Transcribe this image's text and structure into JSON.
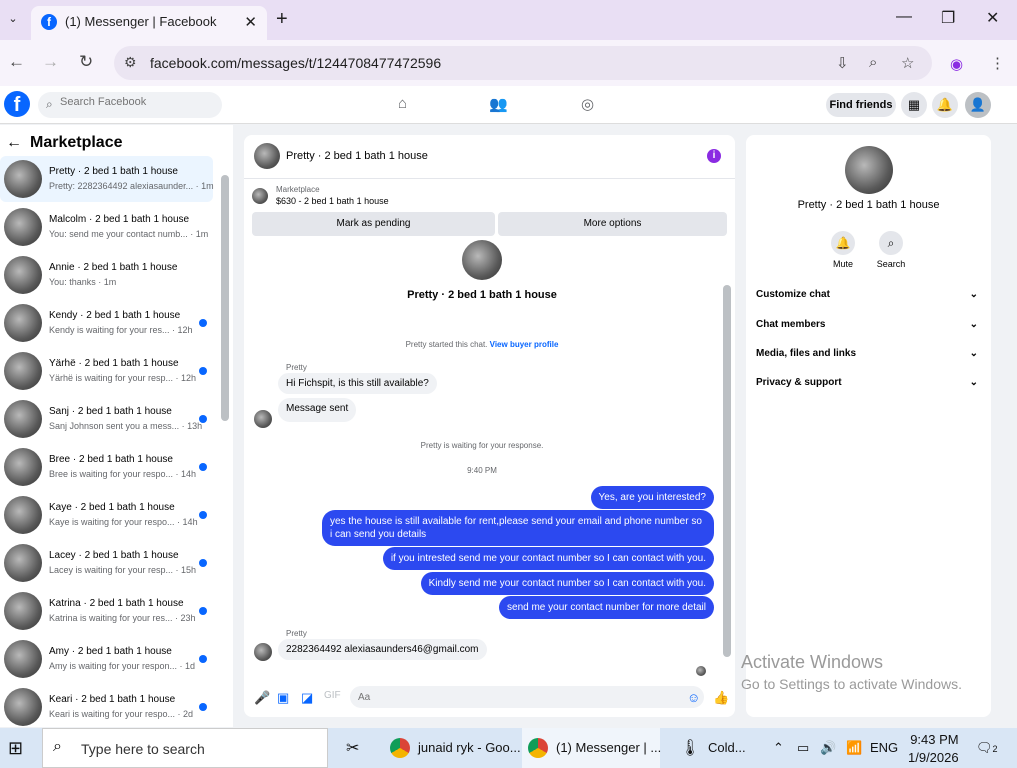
{
  "browser": {
    "tab_title": "(1) Messenger | Facebook",
    "tab_favicon": "f",
    "url": "facebook.com/messages/t/1244708477472596"
  },
  "fb": {
    "logo": "f",
    "search_placeholder": "Search Facebook",
    "find_friends": "Find friends"
  },
  "left": {
    "title": "Marketplace",
    "conversations": [
      {
        "name": "Pretty · 2 bed 1 bath 1 house",
        "snippet": "Pretty: 2282364492 alexiasaunder... · 1m",
        "unread": false
      },
      {
        "name": "Malcolm · 2 bed 1 bath 1 house",
        "snippet": "You: send me your contact numb... · 1m",
        "unread": false
      },
      {
        "name": "Annie · 2 bed 1 bath 1 house",
        "snippet": "You: thanks · 1m",
        "unread": false
      },
      {
        "name": "Kendy · 2 bed 1 bath 1 house",
        "snippet": "Kendy is waiting for your res... · 12h",
        "unread": true
      },
      {
        "name": "Yärhë · 2 bed 1 bath 1 house",
        "snippet": "Yärhë is waiting for your resp... · 12h",
        "unread": true
      },
      {
        "name": "Sanj · 2 bed 1 bath 1 house",
        "snippet": "Sanj Johnson sent you a mess... · 13h",
        "unread": true
      },
      {
        "name": "Bree · 2 bed 1 bath 1 house",
        "snippet": "Bree is waiting for your respo... · 14h",
        "unread": true
      },
      {
        "name": "Kaye · 2 bed 1 bath 1 house",
        "snippet": "Kaye is waiting for your respo... · 14h",
        "unread": true
      },
      {
        "name": "Lacey · 2 bed 1 bath 1 house",
        "snippet": "Lacey is waiting for your resp... · 15h",
        "unread": true
      },
      {
        "name": "Katrina · 2 bed 1 bath 1 house",
        "snippet": "Katrina is waiting for your res... · 23h",
        "unread": true
      },
      {
        "name": "Amy · 2 bed 1 bath 1 house",
        "snippet": "Amy is waiting for your respon... · 1d",
        "unread": true
      },
      {
        "name": "Keari · 2 bed 1 bath 1 house",
        "snippet": "Keari is waiting for your respo... · 2d",
        "unread": true
      }
    ]
  },
  "chat": {
    "title": "Pretty · 2 bed 1 bath 1 house",
    "listing_source": "Marketplace",
    "listing_price": "$630 - 2 bed 1 bath 1 house",
    "mark_pending": "Mark as pending",
    "more_options": "More options",
    "contact_name": "Pretty · 2 bed 1 bath 1 house",
    "started": "Pretty started this chat.",
    "view_profile": "View buyer profile",
    "sender_name": "Pretty",
    "in_msg_1": "Hi Fichspit, is this still available?",
    "in_msg_2": "Message sent",
    "waiting": "Pretty is waiting for your response.",
    "time": "9:40 PM",
    "out_msgs": [
      "Yes, are you interested?",
      "yes the house is still available for rent,please send your email and phone number so i can send you details",
      "if you intrested send me your contact number so I can contact with you.",
      "Kindly send me your contact number so I can contact with you.",
      "send me your contact number for more detail"
    ],
    "sender_name_2": "Pretty",
    "in_msg_3": "2282364492 alexiasaunders46@gmail.com",
    "composer_placeholder": "Aa"
  },
  "right": {
    "name": "Pretty · 2 bed 1 bath 1 house",
    "mute": "Mute",
    "search": "Search",
    "sections": [
      "Customize chat",
      "Chat members",
      "Media, files and links",
      "Privacy & support"
    ]
  },
  "watermark": {
    "line1": "Activate Windows",
    "line2": "Go to Settings to activate Windows."
  },
  "taskbar": {
    "search_text": "Type here to search",
    "app1": "junaid ryk - Goo...",
    "app2": "(1) Messenger | ...",
    "weather": "Cold...",
    "lang": "ENG",
    "time": "9:43 PM",
    "date": "1/9/2026",
    "notif_count": "2"
  },
  "colors": {
    "accent": "#0866ff",
    "outgoing_bubble": "#2c49f0",
    "info_icon": "#8a2be2"
  }
}
